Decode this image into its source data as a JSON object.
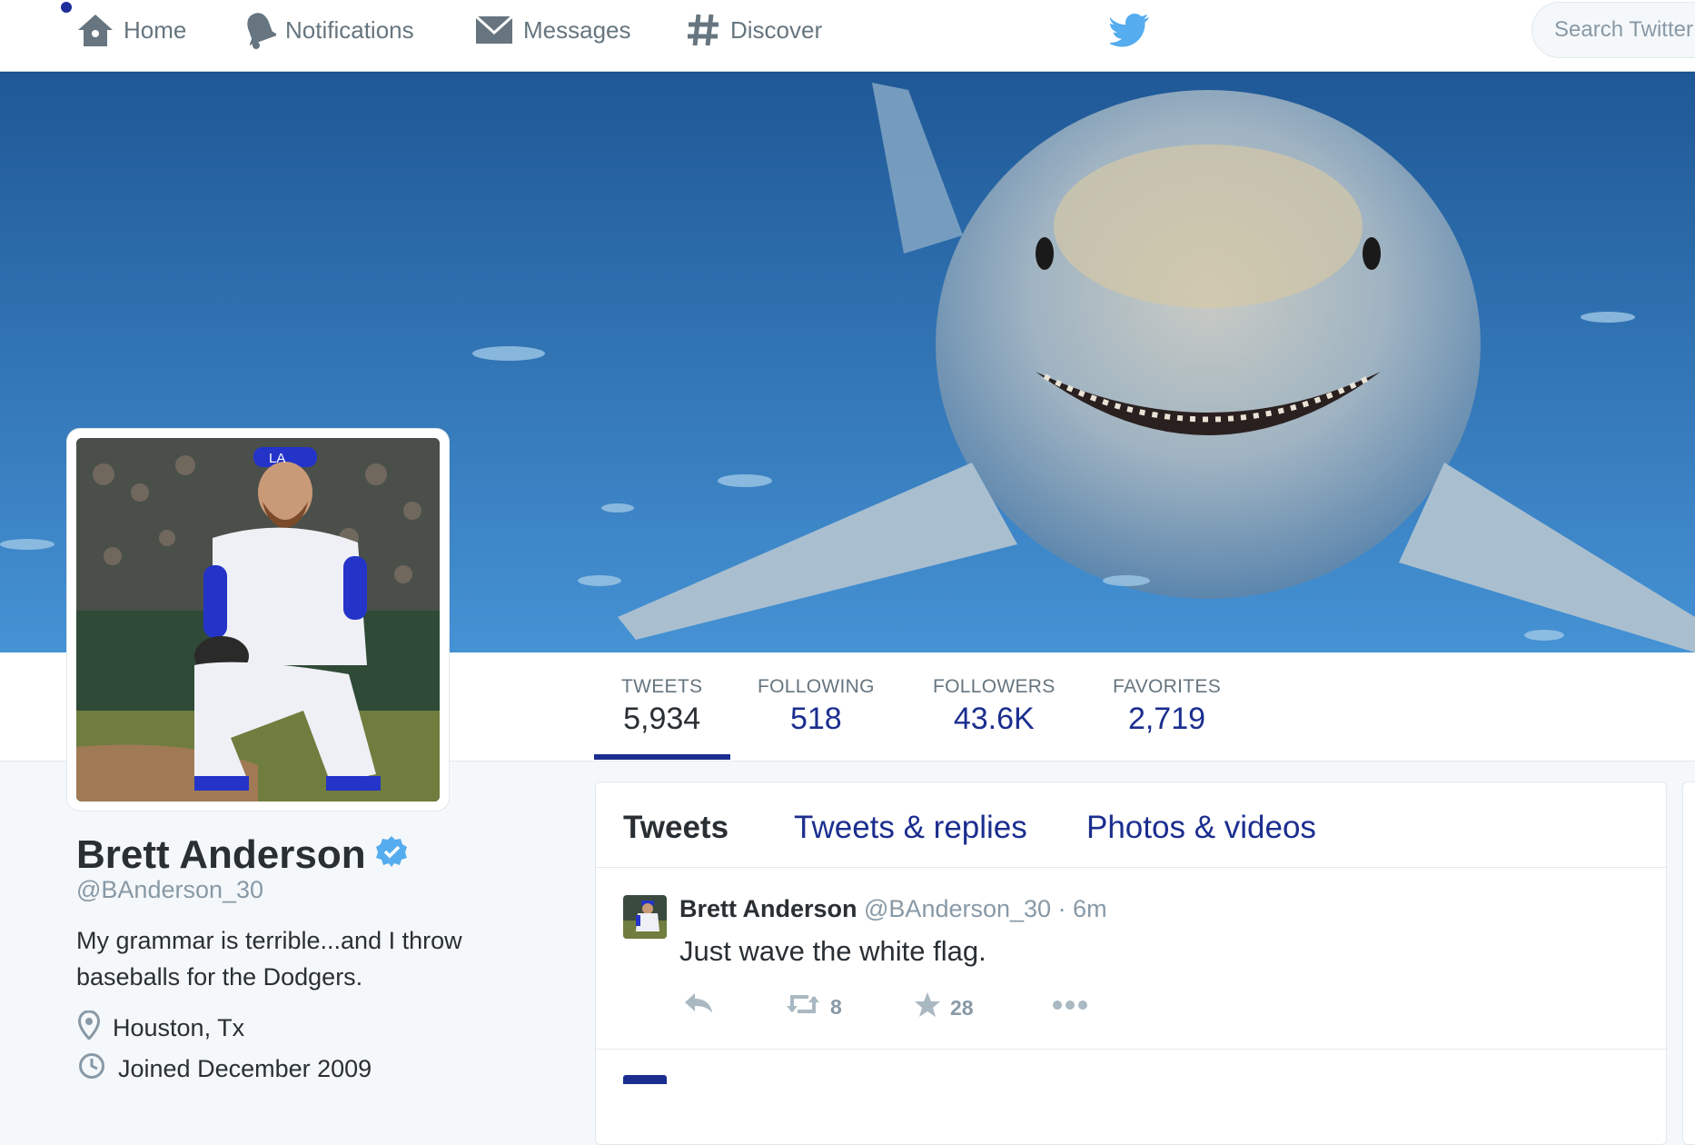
{
  "nav": {
    "home": "Home",
    "notifications": "Notifications",
    "messages": "Messages",
    "discover": "Discover",
    "search_placeholder": "Search Twitter"
  },
  "profile": {
    "name": "Brett Anderson",
    "handle": "@BAnderson_30",
    "bio": "My grammar is terrible...and I throw baseballs for the Dodgers.",
    "location": "Houston, Tx",
    "joined": "Joined December 2009",
    "cap_letters": "LA"
  },
  "stats": [
    {
      "label": "TWEETS",
      "value": "5,934"
    },
    {
      "label": "FOLLOWING",
      "value": "518"
    },
    {
      "label": "FOLLOWERS",
      "value": "43.6K"
    },
    {
      "label": "FAVORITES",
      "value": "2,719"
    }
  ],
  "tabs": [
    {
      "label": "Tweets"
    },
    {
      "label": "Tweets & replies"
    },
    {
      "label": "Photos & videos"
    }
  ],
  "tweet": {
    "name": "Brett Anderson",
    "meta": " @BAnderson_30 · 6m",
    "text": "Just wave the white flag.",
    "retweets": "8",
    "favorites": "28"
  },
  "colors": {
    "accent": "#1b2e8f",
    "banner": "#3a80c4"
  },
  "icons": [
    "home-icon",
    "bell-icon",
    "envelope-icon",
    "hash-icon",
    "twitter-bird-icon",
    "verified-badge-icon",
    "location-pin-icon",
    "clock-icon",
    "reply-icon",
    "retweet-icon",
    "star-icon",
    "more-icon"
  ]
}
